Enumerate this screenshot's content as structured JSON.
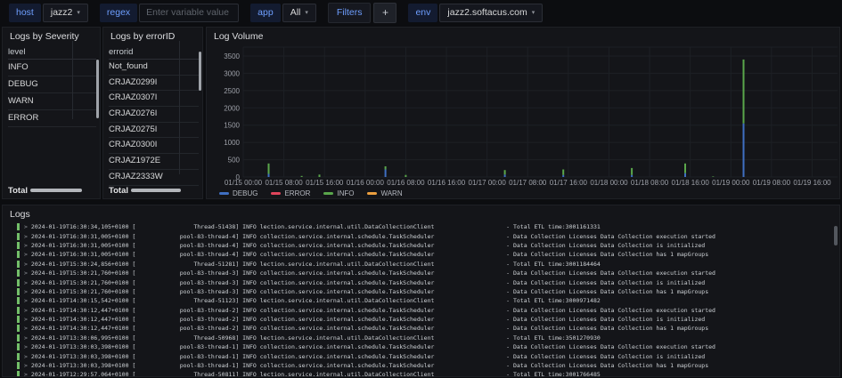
{
  "toolbar": {
    "host_label": "host",
    "host_value": "jazz2",
    "regex_label": "regex",
    "regex_placeholder": "Enter variable value",
    "app_label": "app",
    "app_value": "All",
    "filters_label": "Filters",
    "add_filter_label": "+",
    "env_label": "env",
    "env_value": "jazz2.softacus.com"
  },
  "severity_panel": {
    "title": "Logs by Severity",
    "header": "level",
    "rows": [
      "INFO",
      "DEBUG",
      "WARN",
      "ERROR"
    ],
    "footer": "Total"
  },
  "errorid_panel": {
    "title": "Logs by errorID",
    "header": "errorid",
    "rows": [
      "Not_found",
      "CRJAZ0299I",
      "CRJAZ0307I",
      "CRJAZ0276I",
      "CRJAZ0275I",
      "CRJAZ0300I",
      "CRJAZ1972E",
      "CRJAZ2333W"
    ],
    "footer": "Total"
  },
  "chart_data": {
    "type": "bar",
    "title": "Log Volume",
    "stacked": true,
    "ylim": [
      0,
      3500
    ],
    "y_ticks": [
      0,
      500,
      1000,
      1500,
      2000,
      2500,
      3000,
      3500
    ],
    "x_tick_labels": [
      "01/15 00:00",
      "01/15 08:00",
      "01/15 16:00",
      "01/16 00:00",
      "01/16 08:00",
      "01/16 16:00",
      "01/17 00:00",
      "01/17 08:00",
      "01/17 16:00",
      "01/18 00:00",
      "01/18 08:00",
      "01/18 16:00",
      "01/19 00:00",
      "01/19 08:00",
      "01/19 16:00"
    ],
    "x_tick_hours": [
      0,
      8,
      16,
      24,
      32,
      40,
      48,
      56,
      64,
      72,
      80,
      88,
      96,
      104,
      112
    ],
    "x_domain_hours": [
      0,
      117
    ],
    "grid": true,
    "legend_position": "bottom-left",
    "series": [
      {
        "name": "DEBUG",
        "color": "#3f6fc2"
      },
      {
        "name": "ERROR",
        "color": "#e0455c"
      },
      {
        "name": "INFO",
        "color": "#5aa64b"
      },
      {
        "name": "WARN",
        "color": "#eb9f3f"
      }
    ],
    "points": [
      {
        "time": "01/15 05:00",
        "hour": 5,
        "DEBUG": 90,
        "INFO": 300,
        "ERROR": 0,
        "WARN": 0
      },
      {
        "time": "01/15 11:30",
        "hour": 11.5,
        "DEBUG": 0,
        "INFO": 30,
        "ERROR": 0,
        "WARN": 0
      },
      {
        "time": "01/15 15:00",
        "hour": 15,
        "DEBUG": 0,
        "INFO": 70,
        "ERROR": 0,
        "WARN": 0
      },
      {
        "time": "01/16 04:00",
        "hour": 28,
        "DEBUG": 220,
        "INFO": 90,
        "ERROR": 0,
        "WARN": 0
      },
      {
        "time": "01/16 08:00",
        "hour": 32,
        "DEBUG": 0,
        "INFO": 60,
        "ERROR": 0,
        "WARN": 0
      },
      {
        "time": "01/17 03:30",
        "hour": 51.5,
        "DEBUG": 70,
        "INFO": 130,
        "ERROR": 0,
        "WARN": 0
      },
      {
        "time": "01/17 15:00",
        "hour": 63,
        "DEBUG": 60,
        "INFO": 160,
        "ERROR": 0,
        "WARN": 0
      },
      {
        "time": "01/18 04:30",
        "hour": 76.5,
        "DEBUG": 60,
        "INFO": 200,
        "ERROR": 0,
        "WARN": 0
      },
      {
        "time": "01/18 15:00",
        "hour": 87,
        "DEBUG": 110,
        "INFO": 280,
        "ERROR": 0,
        "WARN": 0
      },
      {
        "time": "01/18 20:30",
        "hour": 92.5,
        "DEBUG": 0,
        "INFO": 15,
        "ERROR": 0,
        "WARN": 0
      },
      {
        "time": "01/19 02:30",
        "hour": 98.5,
        "DEBUG": 1550,
        "INFO": 1850,
        "ERROR": 0,
        "WARN": 0
      }
    ]
  },
  "logs_panel": {
    "title": "Logs",
    "rows": [
      {
        "time": "2024-01-19T16:30:34,105+0100",
        "thread": "Thread-51438",
        "level": "INFO",
        "logger": "lection.service.internal.util.DataCollectionClient",
        "message": "Total ETL time:3001161331"
      },
      {
        "time": "2024-01-19T16:30:31,005+0100",
        "thread": "pool-83-thread-4",
        "level": "INFO",
        "logger": "collection.service.internal.schedule.TaskScheduler",
        "message": "Data Collection Licenses Data Collection execution started"
      },
      {
        "time": "2024-01-19T16:30:31,005+0100",
        "thread": "pool-83-thread-4",
        "level": "INFO",
        "logger": "collection.service.internal.schedule.TaskScheduler",
        "message": "Data Collection Licenses Data Collection is initialized"
      },
      {
        "time": "2024-01-19T16:30:31,005+0100",
        "thread": "pool-83-thread-4",
        "level": "INFO",
        "logger": "collection.service.internal.schedule.TaskScheduler",
        "message": "Data Collection Licenses Data Collection has 1 mapGroups"
      },
      {
        "time": "2024-01-19T15:30:24,856+0100",
        "thread": "Thread-51281",
        "level": "INFO",
        "logger": "lection.service.internal.util.DataCollectionClient",
        "message": "Total ETL time:3001184464"
      },
      {
        "time": "2024-01-19T15:30:21,760+0100",
        "thread": "pool-83-thread-3",
        "level": "INFO",
        "logger": "collection.service.internal.schedule.TaskScheduler",
        "message": "Data Collection Licenses Data Collection execution started"
      },
      {
        "time": "2024-01-19T15:30:21,760+0100",
        "thread": "pool-83-thread-3",
        "level": "INFO",
        "logger": "collection.service.internal.schedule.TaskScheduler",
        "message": "Data Collection Licenses Data Collection is initialized"
      },
      {
        "time": "2024-01-19T15:30:21,760+0100",
        "thread": "pool-83-thread-3",
        "level": "INFO",
        "logger": "collection.service.internal.schedule.TaskScheduler",
        "message": "Data Collection Licenses Data Collection has 1 mapGroups"
      },
      {
        "time": "2024-01-19T14:30:15,542+0100",
        "thread": "Thread-51123",
        "level": "INFO",
        "logger": "lection.service.internal.util.DataCollectionClient",
        "message": "Total ETL time:3000971482"
      },
      {
        "time": "2024-01-19T14:30:12,447+0100",
        "thread": "pool-83-thread-2",
        "level": "INFO",
        "logger": "collection.service.internal.schedule.TaskScheduler",
        "message": "Data Collection Licenses Data Collection execution started"
      },
      {
        "time": "2024-01-19T14:30:12,447+0100",
        "thread": "pool-83-thread-2",
        "level": "INFO",
        "logger": "collection.service.internal.schedule.TaskScheduler",
        "message": "Data Collection Licenses Data Collection is initialized"
      },
      {
        "time": "2024-01-19T14:30:12,447+0100",
        "thread": "pool-83-thread-2",
        "level": "INFO",
        "logger": "collection.service.internal.schedule.TaskScheduler",
        "message": "Data Collection Licenses Data Collection has 1 mapGroups"
      },
      {
        "time": "2024-01-19T13:30:06,995+0100",
        "thread": "Thread-50968",
        "level": "INFO",
        "logger": "lection.service.internal.util.DataCollectionClient",
        "message": "Total ETL time:3501270930"
      },
      {
        "time": "2024-01-19T13:30:03,398+0100",
        "thread": "pool-83-thread-1",
        "level": "INFO",
        "logger": "collection.service.internal.schedule.TaskScheduler",
        "message": "Data Collection Licenses Data Collection execution started"
      },
      {
        "time": "2024-01-19T13:30:03,398+0100",
        "thread": "pool-83-thread-1",
        "level": "INFO",
        "logger": "collection.service.internal.schedule.TaskScheduler",
        "message": "Data Collection Licenses Data Collection is initialized"
      },
      {
        "time": "2024-01-19T13:30:03,398+0100",
        "thread": "pool-83-thread-1",
        "level": "INFO",
        "logger": "collection.service.internal.schedule.TaskScheduler",
        "message": "Data Collection Licenses Data Collection has 1 mapGroups"
      },
      {
        "time": "2024-01-19T12:29:57,064+0100",
        "thread": "Thread-50811",
        "level": "INFO",
        "logger": "lection.service.internal.util.DataCollectionClient",
        "message": "Total ETL time:3001766485"
      }
    ]
  },
  "colors": {
    "info_level_bar": "#73bf69",
    "accent_blue": "#6e9fff"
  }
}
